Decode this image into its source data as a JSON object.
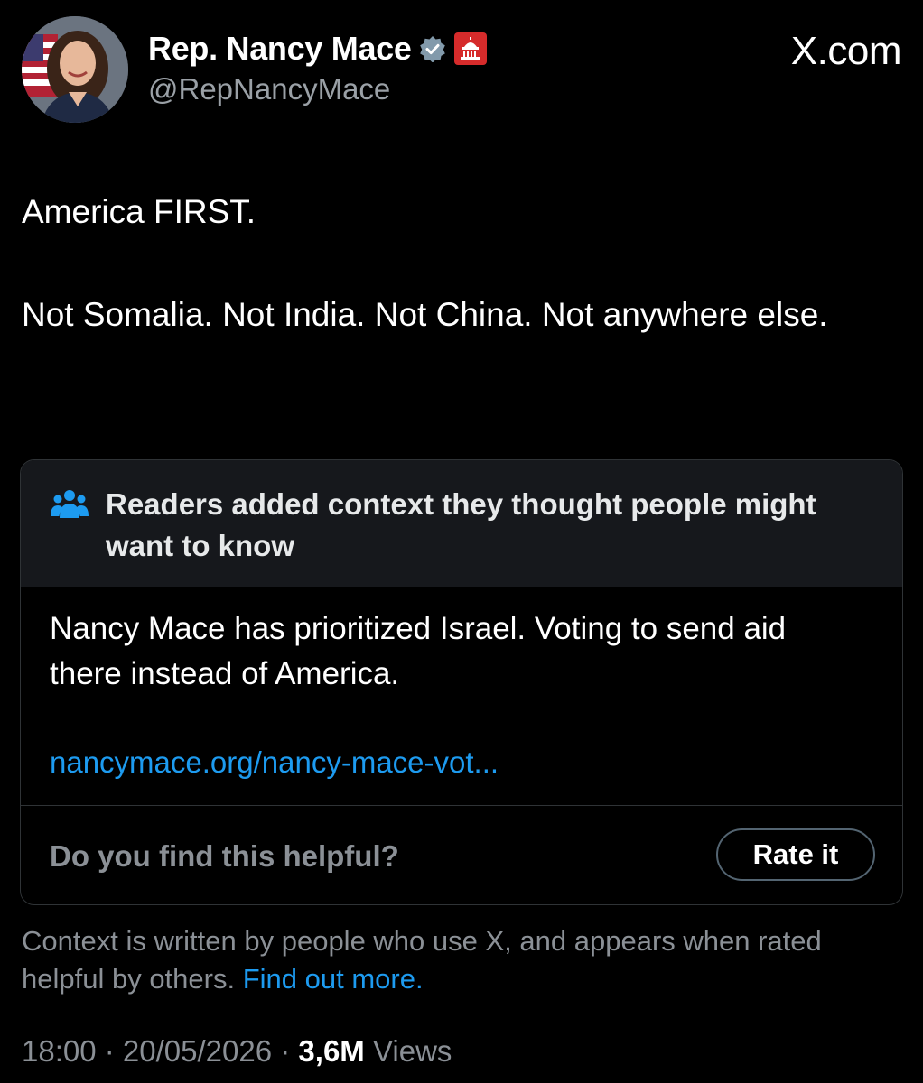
{
  "author": {
    "display_name": "Rep. Nancy Mace",
    "handle": "@RepNancyMace",
    "verified_icon": "verified-badge-icon",
    "affiliation_icon": "capitol-building-icon"
  },
  "site_label": "X.com",
  "tweet": {
    "paragraphs": [
      "America FIRST.",
      "Not Somalia. Not India. Not China. Not anywhere else."
    ]
  },
  "community_note": {
    "header_icon": "people-group-icon",
    "header": "Readers added context they thought people might want to know",
    "body": "Nancy Mace has prioritized Israel. Voting to send aid there instead of America.",
    "link_text": "nancymace.org/nancy-mace-vot...",
    "helpful_question": "Do you find this helpful?",
    "rate_button": "Rate it"
  },
  "context_footer": {
    "text": "Context is written by people who use X, and appears when rated helpful by others.",
    "link": "Find out more."
  },
  "meta": {
    "time": "18:00",
    "separator": " · ",
    "date": "20/05/2026",
    "views_count": "3,6M",
    "views_label": "Views"
  },
  "colors": {
    "background": "#000000",
    "text": "#ffffff",
    "muted": "#8b9096",
    "link": "#1d9bf0",
    "note_header_bg": "#16181c",
    "border": "#2f3336"
  }
}
